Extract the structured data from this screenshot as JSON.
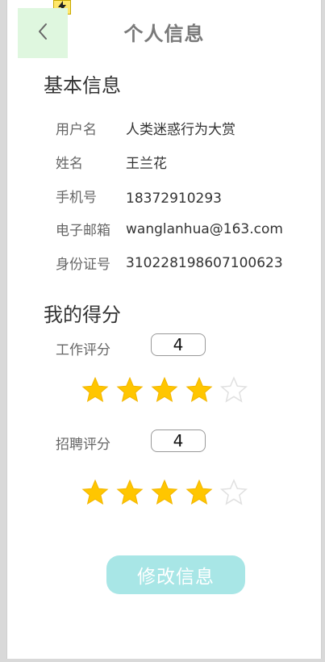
{
  "header": {
    "title": "个人信息",
    "back_icon": "chevron-left-icon",
    "badge_icon": "lightning-icon",
    "back_bg_color": "#dff7df",
    "badge_color": "#ffe76a"
  },
  "basic_info": {
    "title": "基本信息",
    "rows": [
      {
        "label": "用户名",
        "value": "人类迷惑行为大赏"
      },
      {
        "label": "姓名",
        "value": "王兰花"
      },
      {
        "label": "手机号",
        "value": "18372910293"
      },
      {
        "label": "电子邮箱",
        "value": "wanglanhua@163.com"
      },
      {
        "label": "身份证号",
        "value": "310228198607100623"
      }
    ]
  },
  "scores": {
    "title": "我的得分",
    "items": [
      {
        "label": "工作评分",
        "value": "4",
        "rating": 4,
        "max": 5
      },
      {
        "label": "招聘评分",
        "value": "4",
        "rating": 4,
        "max": 5
      }
    ],
    "star_color": "#ffc600",
    "empty_star_color": "#e0e0e0"
  },
  "actions": {
    "edit_label": "修改信息",
    "edit_color": "#a8e6e6"
  }
}
